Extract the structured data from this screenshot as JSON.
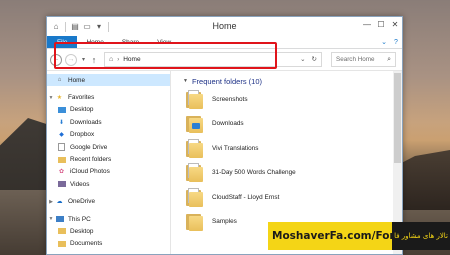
{
  "window": {
    "title": "Home",
    "controls": [
      "—",
      "☐",
      "✕"
    ]
  },
  "ribbon": {
    "tabs": [
      "File",
      "Home",
      "Share",
      "View"
    ]
  },
  "address_bar": {
    "path_home_icon": "home-icon",
    "path": "Home"
  },
  "search": {
    "placeholder": "Search Home"
  },
  "sidebar": {
    "items": [
      {
        "label": "Home",
        "icon": "home-icon",
        "selected": true,
        "level": 0
      },
      {
        "label": "Favorites",
        "icon": "star-icon",
        "level": 0
      },
      {
        "label": "Desktop",
        "icon": "desktop-icon",
        "level": 1
      },
      {
        "label": "Downloads",
        "icon": "downloads-icon",
        "level": 1
      },
      {
        "label": "Dropbox",
        "icon": "dropbox-icon",
        "level": 1
      },
      {
        "label": "Google Drive",
        "icon": "google-drive-icon",
        "level": 1
      },
      {
        "label": "Recent folders",
        "icon": "recent-folders-icon",
        "level": 1
      },
      {
        "label": "iCloud Photos",
        "icon": "icloud-photos-icon",
        "level": 1
      },
      {
        "label": "Videos",
        "icon": "videos-icon",
        "level": 1
      },
      {
        "label": "OneDrive",
        "icon": "onedrive-icon",
        "level": 0
      },
      {
        "label": "This PC",
        "icon": "this-pc-icon",
        "level": 0
      },
      {
        "label": "Desktop",
        "icon": "desktop-icon",
        "level": 1
      },
      {
        "label": "Documents",
        "icon": "documents-icon",
        "level": 1
      }
    ]
  },
  "main": {
    "group_title": "Frequent folders (10)",
    "folders": [
      {
        "label": "Screenshots",
        "icon": "folder-icon"
      },
      {
        "label": "Downloads",
        "icon": "folder-downloads-icon"
      },
      {
        "label": "Vivi Translations",
        "icon": "folder-icon"
      },
      {
        "label": "31-Day 500 Words Challenge",
        "icon": "folder-icon"
      },
      {
        "label": "CloudStaff - Lloyd Ernst",
        "icon": "folder-icon"
      },
      {
        "label": "Samples",
        "icon": "folder-icon"
      }
    ]
  },
  "watermark": {
    "text": "MoshaverFa.com/Forum",
    "text_fa": "تالار های مشاور فا"
  },
  "colors": {
    "file_tab": "#1979ca",
    "highlight": "#e0141b",
    "watermark_bg": "#f4d516",
    "group_title": "#1e3287"
  }
}
